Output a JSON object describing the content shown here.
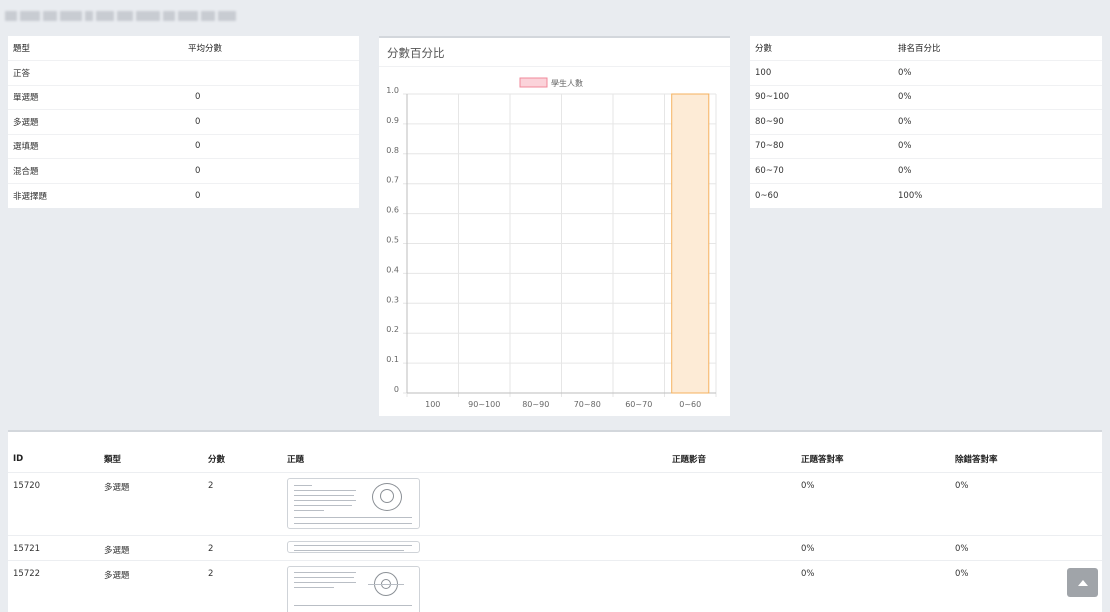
{
  "type_table": {
    "headers": [
      "題型",
      "平均分數"
    ],
    "rows": [
      {
        "type": "正答",
        "avg": ""
      },
      {
        "type": "單選題",
        "avg": "0"
      },
      {
        "type": "多選題",
        "avg": "0"
      },
      {
        "type": "選填題",
        "avg": "0"
      },
      {
        "type": "混合題",
        "avg": "0"
      },
      {
        "type": "非選擇題",
        "avg": "0"
      }
    ]
  },
  "chart_panel": {
    "title": "分數百分比"
  },
  "chart_data": {
    "type": "bar",
    "categories": [
      "100",
      "90~100",
      "80~90",
      "70~80",
      "60~70",
      "0~60"
    ],
    "series": [
      {
        "name": "學生人數",
        "values": [
          0,
          0,
          0,
          0,
          0,
          1
        ]
      }
    ],
    "ylim": [
      0,
      1
    ],
    "yticks": [
      "0",
      "0.1",
      "0.2",
      "0.3",
      "0.4",
      "0.5",
      "0.6",
      "0.7",
      "0.8",
      "0.9",
      "1.0"
    ],
    "grid": true,
    "legend": "top-center",
    "bar_fill": "#fdebd6",
    "bar_stroke": "#f5b25f",
    "legend_fill": "#fbd3da",
    "legend_stroke": "#f08a9b"
  },
  "rank_table": {
    "headers": [
      "分數",
      "排名百分比"
    ],
    "rows": [
      {
        "score": "100",
        "pct": "0%"
      },
      {
        "score": "90~100",
        "pct": "0%"
      },
      {
        "score": "80~90",
        "pct": "0%"
      },
      {
        "score": "70~80",
        "pct": "0%"
      },
      {
        "score": "60~70",
        "pct": "0%"
      },
      {
        "score": "0~60",
        "pct": "100%"
      }
    ]
  },
  "question_table": {
    "headers": [
      "ID",
      "類型",
      "分數",
      "正題",
      "正題影音",
      "正題答對率",
      "除錯答對率"
    ],
    "rows": [
      {
        "id": "15720",
        "type": "多選題",
        "score": "2",
        "rate": "0%",
        "rate2": "0%"
      },
      {
        "id": "15721",
        "type": "多選題",
        "score": "2",
        "rate": "0%",
        "rate2": "0%"
      },
      {
        "id": "15722",
        "type": "多選題",
        "score": "2",
        "rate": "0%",
        "rate2": "0%"
      }
    ]
  }
}
